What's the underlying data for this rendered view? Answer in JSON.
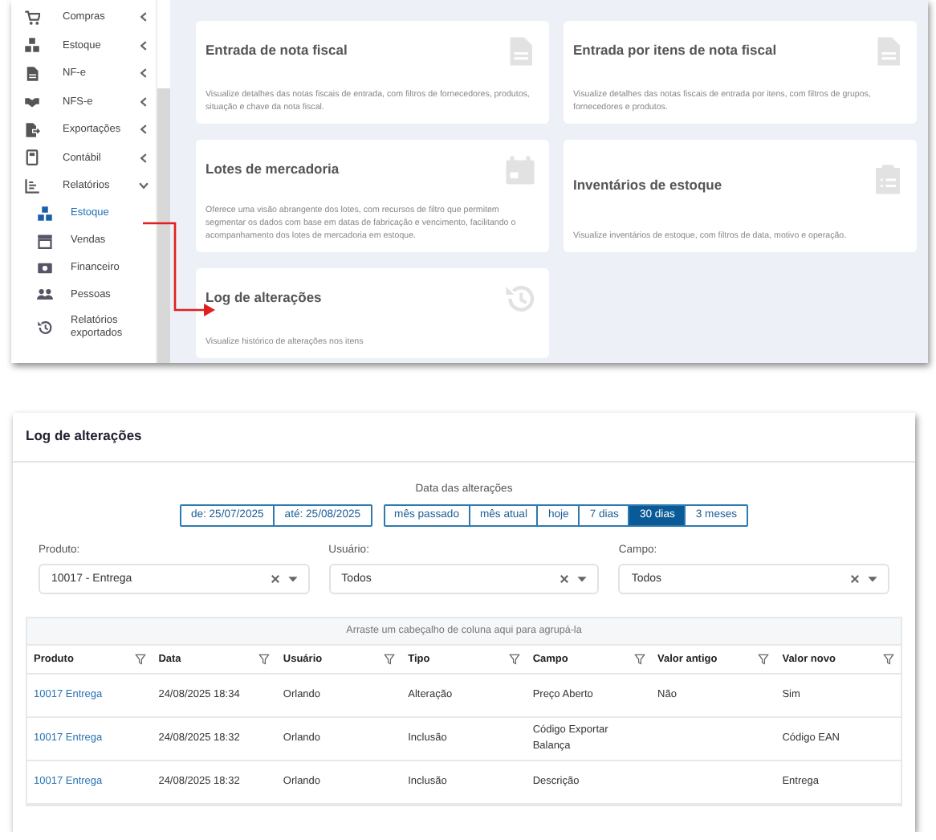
{
  "sidebar": {
    "items": [
      {
        "label": "Compras",
        "expanded": false
      },
      {
        "label": "Estoque",
        "expanded": false
      },
      {
        "label": "NF-e",
        "expanded": false
      },
      {
        "label": "NFS-e",
        "expanded": false
      },
      {
        "label": "Exportações",
        "expanded": false
      },
      {
        "label": "Contábil",
        "expanded": false
      },
      {
        "label": "Relatórios",
        "expanded": true,
        "children": [
          {
            "label": "Estoque",
            "selected": true
          },
          {
            "label": "Vendas",
            "selected": false
          },
          {
            "label": "Financeiro",
            "selected": false
          },
          {
            "label": "Pessoas",
            "selected": false
          },
          {
            "label": "Relatórios exportados",
            "selected": false
          }
        ]
      }
    ]
  },
  "cards": [
    {
      "title": "Entrada de nota fiscal",
      "description": "Visualize detalhes das notas fiscais de entrada, com filtros de fornecedores, produtos, situação e chave da nota fiscal."
    },
    {
      "title": "Entrada por itens de nota fiscal",
      "description": "Visualize detalhes das notas fiscais de entrada por itens, com filtros de grupos, fornecedores e produtos."
    },
    {
      "title": "Lotes de mercadoria",
      "description": "Oferece uma visão abrangente dos lotes, com recursos de filtro que permitem segmentar os dados com base em datas de fabricação e vencimento, facilitando o acompanhamento dos lotes de mercadoria em estoque."
    },
    {
      "title": "Inventários de estoque",
      "description": "Visualize inventários de estoque, com filtros de data, motivo e operação."
    },
    {
      "title": "Log de alterações",
      "description": "Visualize histórico de alterações nos itens"
    }
  ],
  "log": {
    "title": "Log de alterações",
    "date_label": "Data das alterações",
    "range": [
      "de: 25/07/2025",
      "até: 25/08/2025"
    ],
    "periods": [
      {
        "label": "mês passado",
        "selected": false
      },
      {
        "label": "mês atual",
        "selected": false
      },
      {
        "label": "hoje",
        "selected": false
      },
      {
        "label": "7 dias",
        "selected": false
      },
      {
        "label": "30 dias",
        "selected": true
      },
      {
        "label": "3 meses",
        "selected": false
      }
    ],
    "filters": [
      {
        "label": "Produto:",
        "value": "10017 - Entrega"
      },
      {
        "label": "Usuário:",
        "value": "Todos"
      },
      {
        "label": "Campo:",
        "value": "Todos"
      }
    ],
    "group_hint": "Arraste um cabeçalho de coluna aqui para agrupá-la",
    "table": {
      "columns": [
        "Produto",
        "Data",
        "Usuário",
        "Tipo",
        "Campo",
        "Valor antigo",
        "Valor novo"
      ],
      "rows": [
        [
          "10017 Entrega",
          "24/08/2025 18:34",
          "Orlando",
          "Alteração",
          "Preço Aberto",
          "Não",
          "Sim"
        ],
        [
          "10017 Entrega",
          "24/08/2025 18:32",
          "Orlando",
          "Inclusão",
          "Código Exportar Balança",
          "",
          "Código EAN"
        ],
        [
          "10017 Entrega",
          "24/08/2025 18:32",
          "Orlando",
          "Inclusão",
          "Descrição",
          "",
          "Entrega"
        ]
      ]
    }
  }
}
